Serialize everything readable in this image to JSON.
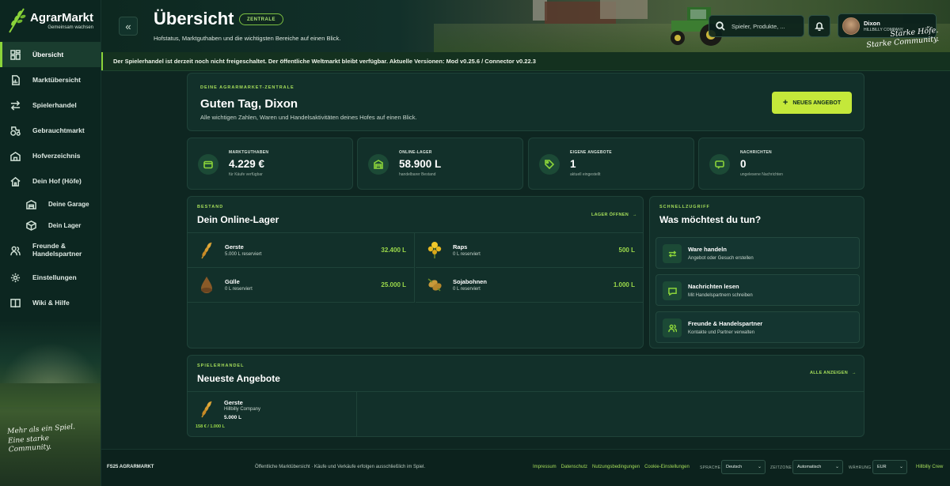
{
  "brand": {
    "title": "AgrarMarkt",
    "subtitle": "Gemeinsam wachsen"
  },
  "sidebar": {
    "items": [
      {
        "label": "Übersicht",
        "icon": "dashboard-icon"
      },
      {
        "label": "Marktübersicht",
        "icon": "document-chart-icon"
      },
      {
        "label": "Spielerhandel",
        "icon": "swap-arrows-icon"
      },
      {
        "label": "Gebrauchtmarkt",
        "icon": "tractor-icon"
      },
      {
        "label": "Hofverzeichnis",
        "icon": "barn-icon"
      },
      {
        "label": "Dein Hof (Höfe)",
        "icon": "home-icon"
      },
      {
        "label": "Deine Garage",
        "icon": "garage-icon"
      },
      {
        "label": "Dein Lager",
        "icon": "box-icon"
      },
      {
        "label": "Freunde & Handelspartner",
        "icon": "users-icon"
      },
      {
        "label": "Einstellungen",
        "icon": "gear-icon"
      },
      {
        "label": "Wiki & Hilfe",
        "icon": "book-icon"
      }
    ],
    "quote": "Mehr als ein Spiel. Eine starke Community."
  },
  "header": {
    "title": "Übersicht",
    "badge": "ZENTRALE",
    "subtitle": "Hofstatus, Marktguthaben und die wichtigsten Bereiche auf einen Blick.",
    "search_placeholder": "Spieler, Produkte, ...",
    "user_name": "Dixon",
    "user_company": "HILLBILLY COMPANY",
    "quote": "Starke Höfe. Starke Community."
  },
  "banner": "Der Spielerhandel ist derzeit noch nicht freigeschaltet. Der öffentliche Weltmarkt bleibt verfügbar. Aktuelle Versionen: Mod v0.25.6 / Connector v0.22.3",
  "welcome": {
    "eyebrow": "DEINE AGRARMARKET-ZENTRALE",
    "title": "Guten Tag, Dixon",
    "text": "Alle wichtigen Zahlen, Waren und Handelsaktivitäten deines Hofes auf einen Blick.",
    "button": "NEUES ANGEBOT"
  },
  "stats": [
    {
      "label": "MARKTGUTHABEN",
      "value": "4.229 €",
      "hint": "für Käufe verfügbar",
      "icon": "wallet-icon"
    },
    {
      "label": "ONLINE-LAGER",
      "value": "58.900 L",
      "hint": "handelbarer Bestand",
      "icon": "warehouse-icon"
    },
    {
      "label": "EIGENE ANGEBOTE",
      "value": "1",
      "hint": "aktuell eingestellt",
      "icon": "tag-icon"
    },
    {
      "label": "NACHRICHTEN",
      "value": "0",
      "hint": "ungelesene Nachrichten",
      "icon": "message-icon"
    }
  ],
  "lager": {
    "eyebrow": "BESTAND",
    "title": "Dein Online-Lager",
    "link": "LAGER ÖFFNEN",
    "items": [
      {
        "name": "Gerste",
        "reserved": "5.000 L reserviert",
        "qty": "32.400 L",
        "icon": "barley-icon"
      },
      {
        "name": "Raps",
        "reserved": "0 L reserviert",
        "qty": "500 L",
        "icon": "rapeseed-icon"
      },
      {
        "name": "Gülle",
        "reserved": "0 L reserviert",
        "qty": "25.000 L",
        "icon": "slurry-icon"
      },
      {
        "name": "Sojabohnen",
        "reserved": "0 L reserviert",
        "qty": "1.000 L",
        "icon": "soybean-icon"
      }
    ]
  },
  "quick": {
    "eyebrow": "SCHNELLZUGRIFF",
    "title": "Was möchtest du tun?",
    "actions": [
      {
        "title": "Ware handeln",
        "sub": "Angebot oder Gesuch erstellen",
        "icon": "swap-icon"
      },
      {
        "title": "Nachrichten lesen",
        "sub": "Mit Handelspartnern schreiben",
        "icon": "chat-icon"
      },
      {
        "title": "Freunde & Handelspartner",
        "sub": "Kontakte und Partner verwalten",
        "icon": "users-icon"
      }
    ]
  },
  "offers": {
    "eyebrow": "SPIELERHANDEL",
    "title": "Neueste Angebote",
    "link": "ALLE ANZEIGEN",
    "items": [
      {
        "name": "Gerste",
        "company": "Hillbilly Company",
        "amount": "5.000 L",
        "price": "158 € / 1.000 L",
        "icon": "barley-icon"
      }
    ]
  },
  "footer": {
    "brand": "FS25 AGRARMARKT",
    "note": "Öffentliche Marktübersicht · Käufe und Verkäufe erfolgen ausschließlich im Spiel.",
    "links": [
      "Impressum",
      "Datenschutz",
      "Nutzungsbedingungen",
      "Cookie-Einstellungen"
    ],
    "language_label": "SPRACHE",
    "language": "Deutsch",
    "timezone_label": "ZEITZONE",
    "timezone": "Automatisch",
    "currency_label": "WÄHRUNG",
    "currency": "EUR",
    "crew": "Hillbilly Crew"
  },
  "colors": {
    "accent": "#8bd43a",
    "button": "#c4e83a",
    "background": "#0e2621",
    "card": "#12302a"
  }
}
